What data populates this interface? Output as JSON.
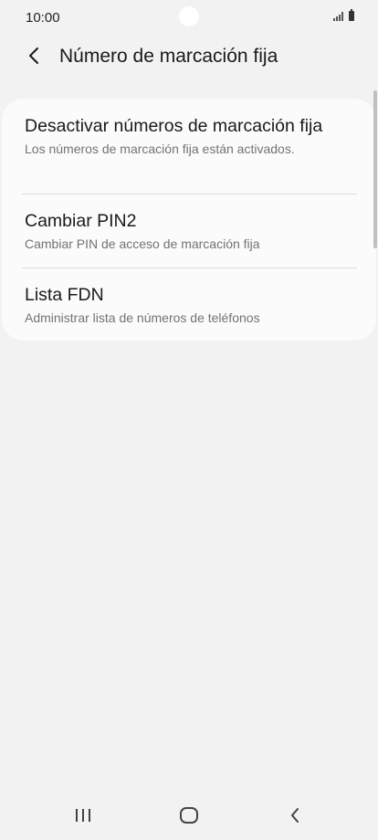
{
  "status_bar": {
    "time": "10:00"
  },
  "header": {
    "title": "Número de marcación fija",
    "back_icon": "chevron-left-icon"
  },
  "menu": {
    "items": [
      {
        "title": "Desactivar números de marcación fija",
        "subtitle": "Los números de marcación fija están activados."
      },
      {
        "title": "Cambiar PIN2",
        "subtitle": "Cambiar PIN de acceso de marcación fija"
      },
      {
        "title": "Lista FDN",
        "subtitle": "Administrar lista de números de teléfonos"
      }
    ]
  },
  "nav_bar": {
    "recents_icon": "recents-icon",
    "home_icon": "home-icon",
    "back_icon": "back-icon"
  },
  "colors": {
    "background": "#f2f2f2",
    "card": "#fbfbfb",
    "subtitle": "#737373"
  }
}
